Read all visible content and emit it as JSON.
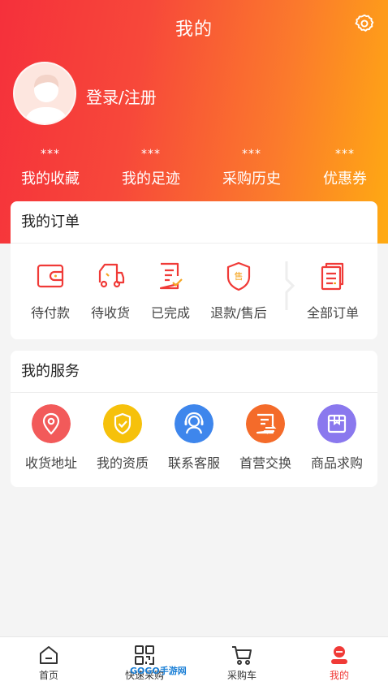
{
  "header": {
    "title": "我的"
  },
  "profile": {
    "login_label": "登录/注册"
  },
  "stats": [
    {
      "value": "***",
      "label": "我的收藏"
    },
    {
      "value": "***",
      "label": "我的足迹"
    },
    {
      "value": "***",
      "label": "采购历史"
    },
    {
      "value": "***",
      "label": "优惠券"
    }
  ],
  "orders": {
    "title": "我的订单",
    "items": [
      {
        "label": "待付款",
        "icon": "wallet-icon"
      },
      {
        "label": "待收货",
        "icon": "truck-icon"
      },
      {
        "label": "已完成",
        "icon": "completed-doc-icon"
      },
      {
        "label": "退款/售后",
        "icon": "after-sale-shield-icon"
      },
      {
        "label": "全部订单",
        "icon": "all-orders-icon"
      }
    ]
  },
  "services": {
    "title": "我的服务",
    "items": [
      {
        "label": "收货地址",
        "icon": "location-icon",
        "color": "#f25a5a"
      },
      {
        "label": "我的资质",
        "icon": "shield-check-icon",
        "color": "#f6c10b"
      },
      {
        "label": "联系客服",
        "icon": "customer-service-icon",
        "color": "#3e86ec"
      },
      {
        "label": "首营交换",
        "icon": "exchange-doc-icon",
        "color": "#f46b2a"
      },
      {
        "label": "商品求购",
        "icon": "product-box-icon",
        "color": "#8a78ee"
      }
    ]
  },
  "tabbar": {
    "items": [
      {
        "label": "首页",
        "icon": "home-icon"
      },
      {
        "label": "快速采购",
        "icon": "scan-grid-icon"
      },
      {
        "label": "采购车",
        "icon": "cart-icon"
      },
      {
        "label": "我的",
        "icon": "profile-icon"
      }
    ]
  },
  "watermark": "GOGO手游网",
  "colors": {
    "accent": "#f03a37",
    "gradient_start": "#f5303b",
    "gradient_end": "#ffab12"
  }
}
